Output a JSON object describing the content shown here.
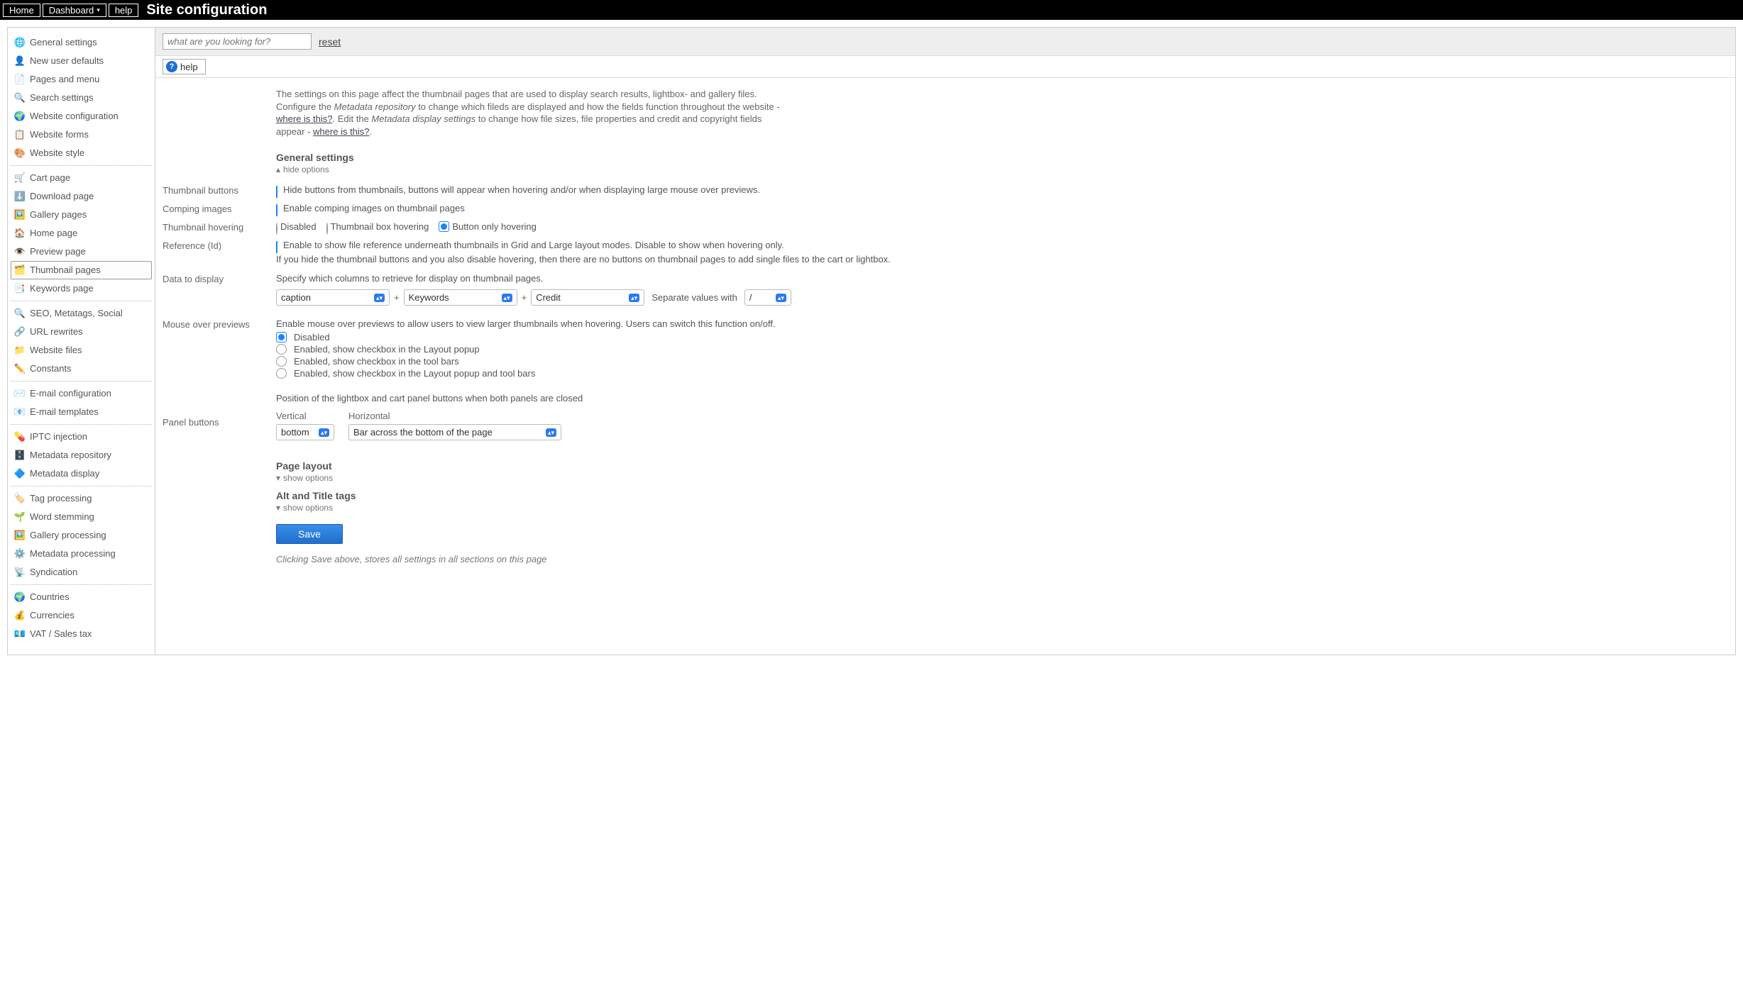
{
  "topbar": {
    "home": "Home",
    "dashboard": "Dashboard",
    "help": "help",
    "title": "Site configuration"
  },
  "search": {
    "placeholder": "what are you looking for?",
    "reset": "reset",
    "help_label": "help"
  },
  "sidebar": {
    "groups": [
      {
        "items": [
          {
            "icon": "🌐",
            "label": "General settings"
          },
          {
            "icon": "👤",
            "label": "New user defaults"
          },
          {
            "icon": "📄",
            "label": "Pages and menu"
          },
          {
            "icon": "🔍",
            "label": "Search settings"
          },
          {
            "icon": "🌍",
            "label": "Website configuration"
          },
          {
            "icon": "📋",
            "label": "Website forms"
          },
          {
            "icon": "🎨",
            "label": "Website style"
          }
        ]
      },
      {
        "items": [
          {
            "icon": "🛒",
            "label": "Cart page"
          },
          {
            "icon": "⬇️",
            "label": "Download page"
          },
          {
            "icon": "🖼️",
            "label": "Gallery pages"
          },
          {
            "icon": "🏠",
            "label": "Home page"
          },
          {
            "icon": "👁️",
            "label": "Preview page"
          },
          {
            "icon": "🗂️",
            "label": "Thumbnail pages",
            "active": true
          },
          {
            "icon": "📑",
            "label": "Keywords page"
          }
        ]
      },
      {
        "items": [
          {
            "icon": "🔍",
            "label": "SEO, Metatags, Social"
          },
          {
            "icon": "🔗",
            "label": "URL rewrites"
          },
          {
            "icon": "📁",
            "label": "Website files"
          },
          {
            "icon": "✏️",
            "label": "Constants"
          }
        ]
      },
      {
        "items": [
          {
            "icon": "✉️",
            "label": "E-mail configuration"
          },
          {
            "icon": "📧",
            "label": "E-mail templates"
          }
        ]
      },
      {
        "items": [
          {
            "icon": "💊",
            "label": "IPTC injection"
          },
          {
            "icon": "🗄️",
            "label": "Metadata repository"
          },
          {
            "icon": "🔷",
            "label": "Metadata display"
          }
        ]
      },
      {
        "items": [
          {
            "icon": "🏷️",
            "label": "Tag processing"
          },
          {
            "icon": "🌱",
            "label": "Word stemming"
          },
          {
            "icon": "🖼️",
            "label": "Gallery processing"
          },
          {
            "icon": "⚙️",
            "label": "Metadata processing"
          },
          {
            "icon": "📡",
            "label": "Syndication"
          }
        ]
      },
      {
        "items": [
          {
            "icon": "🌍",
            "label": "Countries"
          },
          {
            "icon": "💰",
            "label": "Currencies"
          },
          {
            "icon": "💶",
            "label": "VAT / Sales tax"
          }
        ]
      }
    ]
  },
  "intro": {
    "l1": "The settings on this page affect the thumbnail pages that are used to display search results, lightbox- and gallery files.",
    "l2a": "Configure the ",
    "l2b": "Metadata repository",
    "l2c": " to change which fileds are displayed and how the fields function throughout the website - ",
    "where": "where is this?",
    "l3a": ". Edit the ",
    "l3b": "Metadata display settings",
    "l3c": " to change how file sizes, file properties and credit and copyright fields appear - "
  },
  "sections": {
    "general": {
      "title": "General settings",
      "toggle": "hide options"
    },
    "page_layout": {
      "title": "Page layout",
      "toggle": "show options"
    },
    "alt_title": {
      "title": "Alt and Title tags",
      "toggle": "show options"
    }
  },
  "fields": {
    "thumb_buttons": {
      "label": "Thumbnail buttons",
      "text": "Hide buttons from thumbnails, buttons will appear when hovering and/or when displaying large mouse over previews."
    },
    "comping": {
      "label": "Comping images",
      "text": "Enable comping images on thumbnail pages"
    },
    "hovering": {
      "label": "Thumbnail hovering",
      "opts": [
        "Disabled",
        "Thumbnail box hovering",
        "Button only hovering"
      ],
      "selected": 2
    },
    "reference": {
      "label": "Reference (Id)",
      "text": "Enable to show file reference underneath thumbnails in Grid and Large layout modes. Disable to show when hovering only."
    },
    "ref_note": "If you hide the thumbnail buttons and you also disable hovering, then there are no buttons on thumbnail pages to add single files to the cart or lightbox.",
    "data_display": {
      "label": "Data to display",
      "text": "Specify which columns to retrieve for display on thumbnail pages.",
      "sel1": "caption",
      "sel2": "Keywords",
      "sel3": "Credit",
      "sep_lbl": "Separate values with",
      "sep_val": "/"
    },
    "mouseover": {
      "label": "Mouse over previews",
      "text": "Enable mouse over previews to allow users to view larger thumbnails when hovering. Users can switch this function on/off.",
      "opts": [
        "Disabled",
        "Enabled, show checkbox in the Layout popup",
        "Enabled, show checkbox in the tool bars",
        "Enabled, show checkbox in the Layout popup and tool bars"
      ],
      "selected": 0
    },
    "panel": {
      "label": "Panel buttons",
      "text": "Position of the lightbox and cart panel buttons when both panels are closed",
      "vertical_lbl": "Vertical",
      "horizontal_lbl": "Horizontal",
      "vertical_val": "bottom",
      "horizontal_val": "Bar across the bottom of the page"
    }
  },
  "save": {
    "button": "Save",
    "note": "Clicking Save above, stores all settings in all sections on this page"
  }
}
